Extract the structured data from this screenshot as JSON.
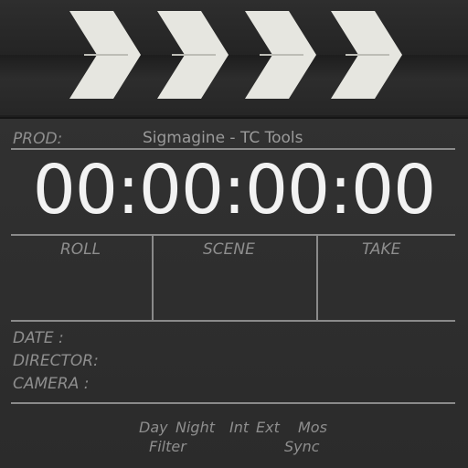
{
  "header": {
    "prod_label": "PROD:",
    "prod_value": "Sigmagine - TC Tools"
  },
  "timecode": "00:00:00:00",
  "columns": {
    "roll": "ROLL",
    "scene": "SCENE",
    "take": "TAKE"
  },
  "info": {
    "date_label": "DATE :",
    "director_label": "DIRECTOR:",
    "camera_label": "CAMERA :"
  },
  "options": {
    "day": "Day",
    "night": "Night",
    "int": "Int",
    "ext": "Ext",
    "mos": "Mos",
    "filter": "Filter",
    "sync": "Sync"
  },
  "icons": {
    "chevron": "chevron-right-icon"
  }
}
